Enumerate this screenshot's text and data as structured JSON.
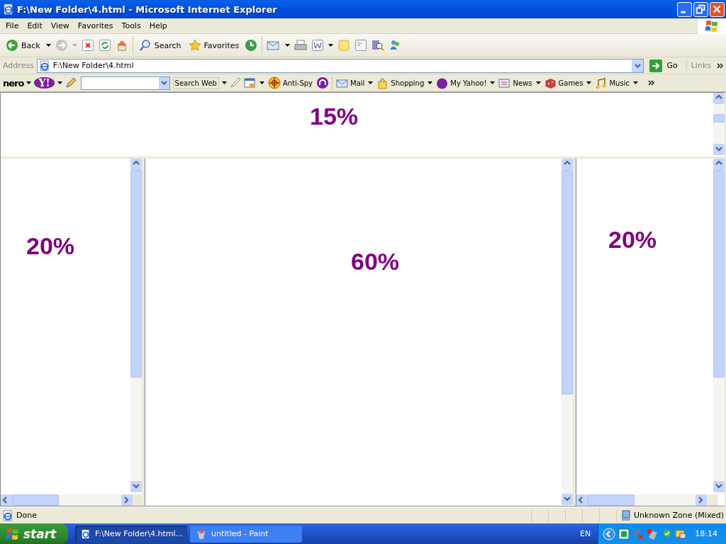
{
  "window": {
    "title": "F:\\New Folder\\4.html - Microsoft Internet Explorer"
  },
  "menu": [
    "File",
    "Edit",
    "View",
    "Favorites",
    "Tools",
    "Help"
  ],
  "toolbar": {
    "back": "Back",
    "search": "Search",
    "favorites": "Favorites"
  },
  "address": {
    "label": "Address",
    "value": "F:\\New Folder\\4.html",
    "go": "Go",
    "links": "Links"
  },
  "yahoo_toolbar": {
    "nero": "nero",
    "yahoo": "Y!",
    "search_button": "Search Web",
    "anti_spy": "Anti-Spy",
    "links": [
      "Mail",
      "Shopping",
      "My Yahoo!",
      "News",
      "Games",
      "Music"
    ]
  },
  "frames": [
    {
      "text": "15%"
    },
    {
      "text": "20%"
    },
    {
      "text": "60%"
    },
    {
      "text": "20%"
    }
  ],
  "status_bar": {
    "text": "Done",
    "zone": "Unknown Zone (Mixed)"
  },
  "taskbar": {
    "start": "start",
    "tasks": [
      {
        "label": "F:\\New Folder\\4.html...",
        "selected": true
      },
      {
        "label": "untitled - Paint",
        "selected": false
      }
    ],
    "language": "EN",
    "clock": "18:14"
  }
}
